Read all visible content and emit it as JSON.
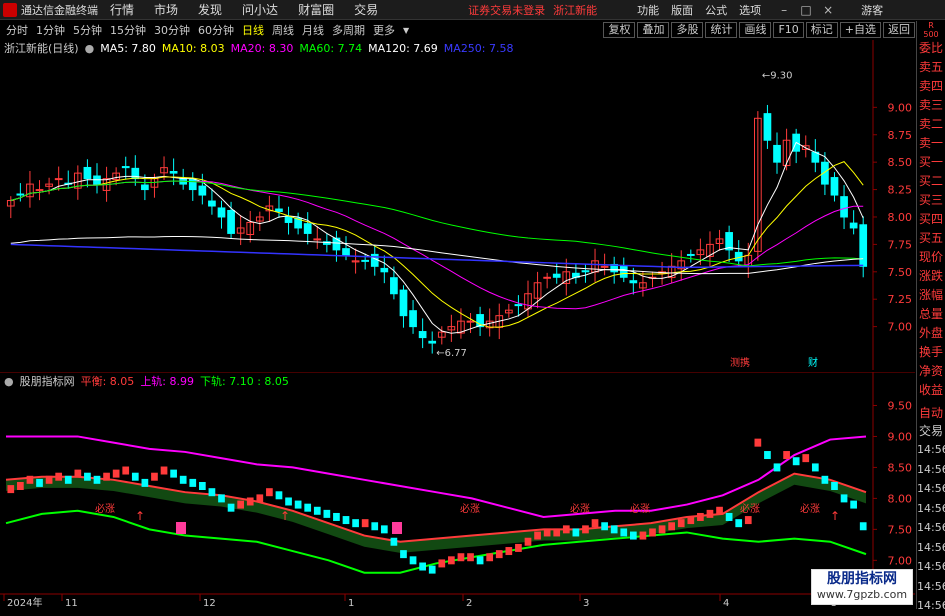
{
  "app": {
    "title": "通达信金融终端"
  },
  "menu": [
    "行情",
    "市场",
    "发现",
    "问小达",
    "财富圈",
    "交易"
  ],
  "notice": {
    "warning": "证券交易未登录",
    "stock": "浙江新能"
  },
  "right_menu": [
    "功能",
    "版面",
    "公式",
    "选项"
  ],
  "guest": "游客",
  "periods": [
    "分时",
    "1分钟",
    "5分钟",
    "15分钟",
    "30分钟",
    "60分钟",
    "日线",
    "周线",
    "月线",
    "多周期",
    "更多"
  ],
  "active_period": "日线",
  "tool_buttons": [
    "复权",
    "叠加",
    "多股",
    "统计",
    "画线",
    "F10",
    "标记",
    "+自选",
    "返回"
  ],
  "side": {
    "badge_top": "R",
    "badge_bottom": "500",
    "tabs": [
      "委比",
      "卖五",
      "卖四",
      "卖三",
      "卖二",
      "卖一",
      "买一",
      "买二",
      "买三",
      "买四",
      "买五",
      "现价",
      "涨跌",
      "涨幅",
      "总量",
      "外盘",
      "换手",
      "净资",
      "收益"
    ],
    "auto": "自动",
    "trade": "交易",
    "times": [
      "14:56",
      "14:56",
      "14:56",
      "14:56",
      "14:56",
      "14:56",
      "14:56",
      "14:56",
      "14:56"
    ]
  },
  "main_legend": {
    "name": "浙江新能(日线)",
    "ma5": "MA5: 7.80",
    "ma10": "MA10: 8.03",
    "ma20": "MA20: 8.30",
    "ma60": "MA60: 7.74",
    "ma120": "MA120: 7.69",
    "ma250": "MA250: 7.58",
    "colors": {
      "ma5": "#ffffff",
      "ma10": "#ffff00",
      "ma20": "#ff00ff",
      "ma60": "#00ff00",
      "ma120": "#ffffff",
      "ma250": "#3333ff"
    }
  },
  "sub_legend": {
    "name": "股朋指标网",
    "mid": "平衡: 8.05",
    "upper": "上轨: 8.99",
    "lower": "下轨: 7.10 : 8.05"
  },
  "chart_data": [
    {
      "type": "candlestick",
      "title": "浙江新能(日线)",
      "y_ticks": [
        9.0,
        8.75,
        8.5,
        8.25,
        8.0,
        7.75,
        7.5,
        7.25,
        7.0
      ],
      "ylim": [
        6.65,
        9.45
      ],
      "annotations": [
        {
          "label": "9.30",
          "value": 9.3
        },
        {
          "label": "6.77",
          "value": 6.77
        }
      ],
      "event_labels": [
        "测携",
        "财"
      ],
      "close": [
        8.15,
        8.2,
        8.3,
        8.25,
        8.3,
        8.35,
        8.3,
        8.4,
        8.35,
        8.3,
        8.35,
        8.4,
        8.45,
        8.35,
        8.25,
        8.35,
        8.45,
        8.4,
        8.3,
        8.25,
        8.2,
        8.1,
        8.0,
        7.85,
        7.9,
        7.95,
        8.0,
        8.1,
        8.05,
        7.95,
        7.9,
        7.85,
        7.8,
        7.75,
        7.7,
        7.65,
        7.6,
        7.6,
        7.55,
        7.5,
        7.3,
        7.1,
        7.0,
        6.9,
        6.85,
        6.95,
        7.0,
        7.05,
        7.05,
        7.0,
        7.05,
        7.1,
        7.15,
        7.2,
        7.3,
        7.4,
        7.45,
        7.45,
        7.5,
        7.45,
        7.5,
        7.6,
        7.55,
        7.5,
        7.45,
        7.4,
        7.4,
        7.45,
        7.5,
        7.55,
        7.6,
        7.65,
        7.7,
        7.75,
        7.8,
        7.7,
        7.6,
        7.65,
        8.9,
        8.7,
        8.5,
        8.7,
        8.6,
        8.65,
        8.5,
        8.3,
        8.2,
        8.0,
        7.9,
        7.55
      ],
      "x_ticks": [
        "2024年",
        "11",
        "12",
        "1",
        "2",
        "3",
        "4",
        "5"
      ]
    },
    {
      "type": "line",
      "title": "股朋指标网",
      "y_ticks": [
        9.5,
        9.0,
        8.5,
        8.0,
        7.5,
        7.0
      ],
      "ylim": [
        6.65,
        9.75
      ],
      "series": [
        {
          "name": "上轨",
          "color": "#ff00ff",
          "values": [
            9.0,
            9.0,
            9.0,
            8.9,
            8.8,
            8.75,
            8.65,
            8.55,
            8.5,
            8.4,
            8.3,
            8.2,
            8.1,
            8.0,
            7.85,
            7.7,
            7.75,
            7.8,
            7.8,
            7.9,
            8.05,
            8.3,
            8.7,
            8.95,
            9.0
          ]
        },
        {
          "name": "平衡",
          "color": "#ff3b3b",
          "values": [
            8.3,
            8.35,
            8.35,
            8.3,
            8.2,
            8.1,
            8.05,
            7.95,
            7.8,
            7.6,
            7.4,
            7.3,
            7.35,
            7.4,
            7.45,
            7.5,
            7.5,
            7.55,
            7.6,
            7.7,
            7.75,
            8.1,
            8.4,
            8.3,
            8.1
          ]
        },
        {
          "name": "下轨",
          "color": "#00ff00",
          "values": [
            7.6,
            7.75,
            7.8,
            7.7,
            7.5,
            7.4,
            7.35,
            7.3,
            7.15,
            7.0,
            6.8,
            6.8,
            6.95,
            7.05,
            7.15,
            7.25,
            7.3,
            7.35,
            7.4,
            7.45,
            7.35,
            7.3,
            7.35,
            7.3,
            7.1
          ]
        }
      ],
      "signal_labels": [
        "必涨"
      ],
      "x_ticks": [
        "2024年",
        "11",
        "12",
        "1",
        "2",
        "3",
        "4",
        "5"
      ]
    }
  ],
  "watermark": {
    "line1": "股朋指标网",
    "line2": "www.7gpzb.com"
  }
}
